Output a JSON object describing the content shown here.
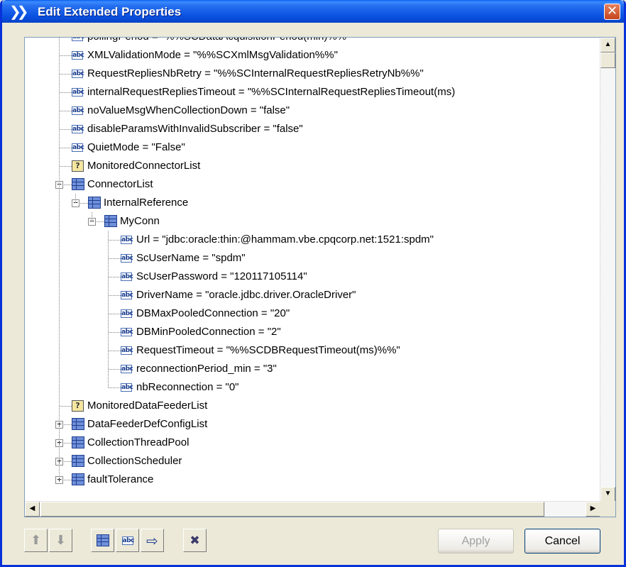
{
  "window": {
    "title": "Edit Extended Properties",
    "title_icon": "double-chevron-icon",
    "close_glyph": "✕"
  },
  "tree": {
    "rows": [
      {
        "level": 2,
        "icon": "abc",
        "label": "pollingPeriod = \"%%SCDataAcquisitionPeriod(min)%%\""
      },
      {
        "level": 2,
        "icon": "abc",
        "label": "XMLValidationMode = \"%%SCXmlMsgValidation%%\""
      },
      {
        "level": 2,
        "icon": "abc",
        "label": "RequestRepliesNbRetry = \"%%SCInternalRequestRepliesRetryNb%%\""
      },
      {
        "level": 2,
        "icon": "abc",
        "label": "internalRequestRepliesTimeout = \"%%SCInternalRequestRepliesTimeout(ms)"
      },
      {
        "level": 2,
        "icon": "abc",
        "label": "noValueMsgWhenCollectionDown = \"false\""
      },
      {
        "level": 2,
        "icon": "abc",
        "label": "disableParamsWithInvalidSubscriber = \"false\""
      },
      {
        "level": 2,
        "icon": "abc",
        "label": "QuietMode = \"False\""
      },
      {
        "level": 2,
        "icon": "q",
        "label": "MonitoredConnectorList"
      },
      {
        "level": 2,
        "icon": "grid",
        "expander": "−",
        "label": "ConnectorList"
      },
      {
        "level": 3,
        "icon": "grid",
        "expander": "−",
        "label": "InternalReference"
      },
      {
        "level": 4,
        "icon": "grid",
        "expander": "−",
        "label": "MyConn"
      },
      {
        "level": 5,
        "icon": "abc",
        "label": "Url = \"jdbc:oracle:thin:@hammam.vbe.cpqcorp.net:1521:spdm\""
      },
      {
        "level": 5,
        "icon": "abc",
        "label": "ScUserName = \"spdm\""
      },
      {
        "level": 5,
        "icon": "abc",
        "label": "ScUserPassword = \"120117105114\""
      },
      {
        "level": 5,
        "icon": "abc",
        "label": "DriverName = \"oracle.jdbc.driver.OracleDriver\""
      },
      {
        "level": 5,
        "icon": "abc",
        "label": "DBMaxPooledConnection = \"20\""
      },
      {
        "level": 5,
        "icon": "abc",
        "label": "DBMinPooledConnection = \"2\""
      },
      {
        "level": 5,
        "icon": "abc",
        "label": "RequestTimeout = \"%%SCDBRequestTimeout(ms)%%\""
      },
      {
        "level": 5,
        "icon": "abc",
        "label": "reconnectionPeriod_min = \"3\""
      },
      {
        "level": 5,
        "icon": "abc",
        "label": "nbReconnection = \"0\""
      },
      {
        "level": 2,
        "icon": "q",
        "label": "MonitoredDataFeederList"
      },
      {
        "level": 2,
        "icon": "grid",
        "expander": "+",
        "label": "DataFeederDefConfigList"
      },
      {
        "level": 2,
        "icon": "grid",
        "expander": "+",
        "label": "CollectionThreadPool"
      },
      {
        "level": 2,
        "icon": "grid",
        "expander": "+",
        "label": "CollectionScheduler"
      },
      {
        "level": 2,
        "icon": "grid",
        "expander": "+",
        "label": "faultTolerance"
      }
    ]
  },
  "icon_text": {
    "abc": "abc",
    "q": "?"
  },
  "scrollbars": {
    "up": "▲",
    "down": "▼",
    "left": "◀",
    "right": "▶"
  },
  "toolbar": {
    "move_up_glyph": "⬆",
    "move_down_glyph": "⬇",
    "add_node_icon": "table-icon",
    "add_attribute_text": "abc",
    "rename_glyph": "⇨",
    "delete_glyph": "✖"
  },
  "buttons": {
    "apply_label": "Apply",
    "cancel_label": "Cancel"
  }
}
